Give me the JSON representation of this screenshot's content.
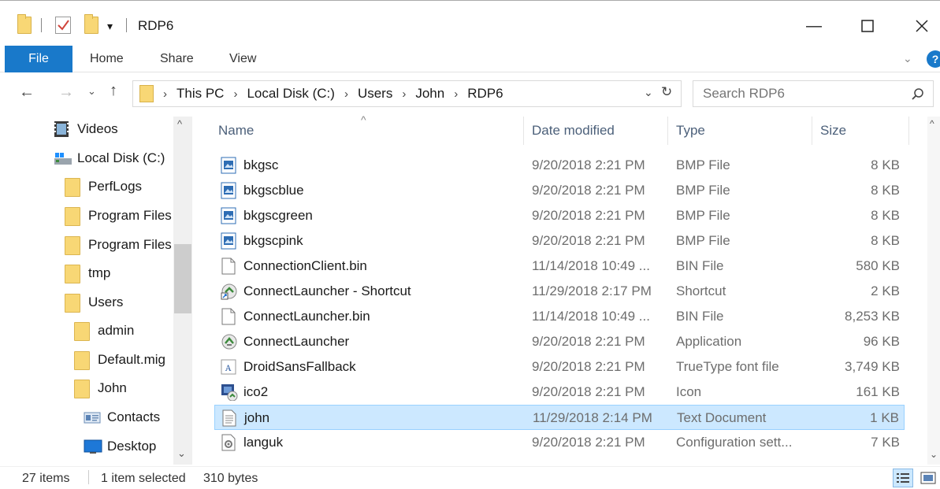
{
  "window": {
    "title": "RDP6",
    "minimize_glyph": "—",
    "maximize_glyph": "☐",
    "close_glyph": "✕"
  },
  "ribbon": {
    "tabs": [
      "File",
      "Home",
      "Share",
      "View"
    ]
  },
  "address": {
    "crumbs": [
      "This PC",
      "Local Disk (C:)",
      "Users",
      "John",
      "RDP6"
    ]
  },
  "search": {
    "placeholder": "Search RDP6"
  },
  "nav_pane": {
    "items": [
      {
        "label": "Videos",
        "icon": "video-icon"
      },
      {
        "label": "Local Disk (C:)",
        "icon": "drive-icon"
      },
      {
        "label": "PerfLogs",
        "icon": "folder-icon"
      },
      {
        "label": "Program Files",
        "icon": "folder-icon"
      },
      {
        "label": "Program Files",
        "icon": "folder-icon"
      },
      {
        "label": "tmp",
        "icon": "folder-icon"
      },
      {
        "label": "Users",
        "icon": "folder-icon"
      },
      {
        "label": "admin",
        "icon": "folder-icon"
      },
      {
        "label": "Default.mig",
        "icon": "folder-icon"
      },
      {
        "label": "John",
        "icon": "folder-icon"
      },
      {
        "label": "Contacts",
        "icon": "contacts-icon"
      },
      {
        "label": "Desktop",
        "icon": "desktop-icon"
      }
    ]
  },
  "columns": [
    "Name",
    "Date modified",
    "Type",
    "Size"
  ],
  "files": [
    {
      "name": "bkgsc",
      "date": "9/20/2018 2:21 PM",
      "type": "BMP File",
      "size": "8 KB",
      "icon": "bmp-icon"
    },
    {
      "name": "bkgscblue",
      "date": "9/20/2018 2:21 PM",
      "type": "BMP File",
      "size": "8 KB",
      "icon": "bmp-icon"
    },
    {
      "name": "bkgscgreen",
      "date": "9/20/2018 2:21 PM",
      "type": "BMP File",
      "size": "8 KB",
      "icon": "bmp-icon"
    },
    {
      "name": "bkgscpink",
      "date": "9/20/2018 2:21 PM",
      "type": "BMP File",
      "size": "8 KB",
      "icon": "bmp-icon"
    },
    {
      "name": "ConnectionClient.bin",
      "date": "11/14/2018 10:49 ...",
      "type": "BIN File",
      "size": "580 KB",
      "icon": "file-icon"
    },
    {
      "name": "ConnectLauncher - Shortcut",
      "date": "11/29/2018 2:17 PM",
      "type": "Shortcut",
      "size": "2 KB",
      "icon": "shortcut-icon"
    },
    {
      "name": "ConnectLauncher.bin",
      "date": "11/14/2018 10:49 ...",
      "type": "BIN File",
      "size": "8,253 KB",
      "icon": "file-icon"
    },
    {
      "name": "ConnectLauncher",
      "date": "9/20/2018 2:21 PM",
      "type": "Application",
      "size": "96 KB",
      "icon": "app-icon"
    },
    {
      "name": "DroidSansFallback",
      "date": "9/20/2018 2:21 PM",
      "type": "TrueType font file",
      "size": "3,749 KB",
      "icon": "font-icon"
    },
    {
      "name": "ico2",
      "date": "9/20/2018 2:21 PM",
      "type": "Icon",
      "size": "161 KB",
      "icon": "ico-icon"
    },
    {
      "name": "john",
      "date": "11/29/2018 2:14 PM",
      "type": "Text Document",
      "size": "1 KB",
      "icon": "text-icon",
      "selected": true
    },
    {
      "name": "languk",
      "date": "9/20/2018 2:21 PM",
      "type": "Configuration sett...",
      "size": "7 KB",
      "icon": "config-icon"
    }
  ],
  "status": {
    "items": "27 items",
    "selected": "1 item selected",
    "bytes": "310 bytes"
  },
  "colors": {
    "accent": "#1979ca",
    "selection": "#cce8ff",
    "folder": "#f8d775"
  }
}
